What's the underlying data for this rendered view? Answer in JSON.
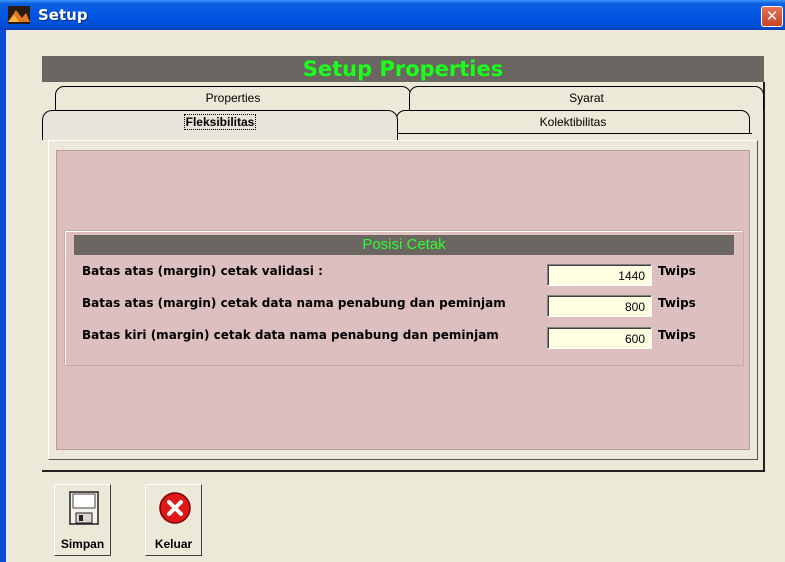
{
  "window": {
    "title": "Setup",
    "close_glyph": "✕"
  },
  "header": {
    "title": "Setup Properties"
  },
  "tabs": [
    {
      "label": "Properties"
    },
    {
      "label": "Syarat"
    },
    {
      "label": "Fleksibilitas",
      "selected": true
    },
    {
      "label": "Kolektibilitas"
    }
  ],
  "group": {
    "title": "Posisi Cetak",
    "rows": [
      {
        "label": "Batas atas (margin) cetak validasi :",
        "value": "1440",
        "unit": "Twips"
      },
      {
        "label": "Batas atas (margin) cetak data nama penabung dan peminjam",
        "value": "800",
        "unit": "Twips"
      },
      {
        "label": "Batas kiri (margin) cetak data nama penabung dan peminjam",
        "value": "600",
        "unit": "Twips"
      }
    ]
  },
  "buttons": {
    "save": "Simpan",
    "exit": "Keluar"
  },
  "icons": {
    "save": "floppy-disk-icon",
    "exit": "close-circle-icon",
    "app": "app-icon"
  },
  "colors": {
    "title_green": "#1aff1a",
    "band_gray": "#6b6661",
    "panel_pink": "#ddbfbf",
    "field_bg": "#fffde2"
  }
}
